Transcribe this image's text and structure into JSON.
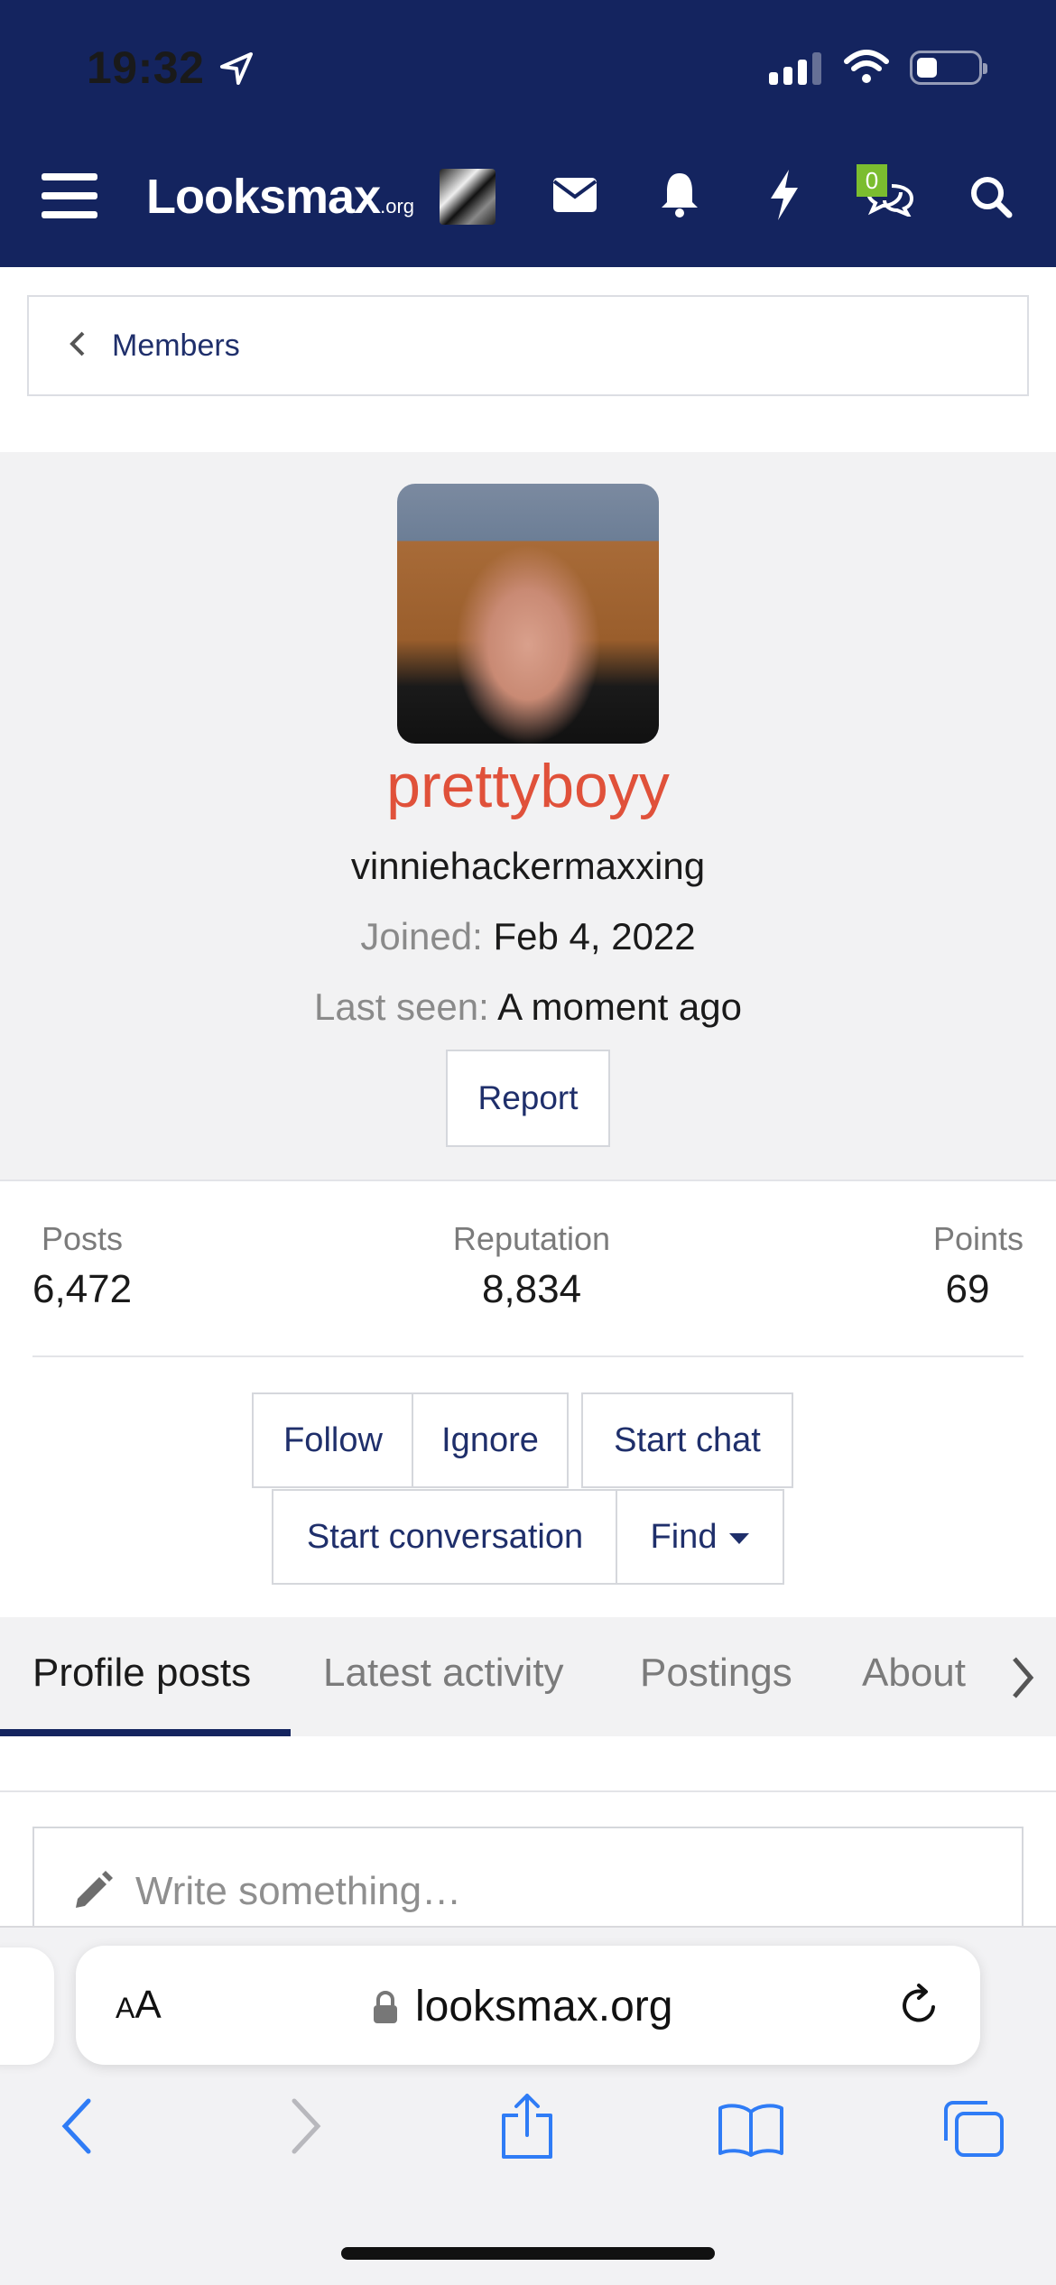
{
  "status_bar": {
    "time": "19:32"
  },
  "header": {
    "logo_main": "Looksmax",
    "logo_suffix": ".org",
    "chat_badge_count": "0",
    "icons": [
      "menu-icon",
      "mail-icon",
      "bell-icon",
      "bolt-icon",
      "chat-icon",
      "search-icon"
    ]
  },
  "breadcrumb": {
    "label": "Members"
  },
  "profile": {
    "username": "prettyboyy",
    "username_color": "#e0513a",
    "title": "vinniehackermaxxing",
    "joined_label": "Joined:",
    "joined_value": "Feb 4, 2022",
    "last_seen_label": "Last seen:",
    "last_seen_value": "A moment ago",
    "report_label": "Report"
  },
  "stats": {
    "posts_label": "Posts",
    "posts_value": "6,472",
    "reputation_label": "Reputation",
    "reputation_value": "8,834",
    "points_label": "Points",
    "points_value": "69"
  },
  "actions": {
    "follow": "Follow",
    "ignore": "Ignore",
    "start_chat": "Start chat",
    "start_conversation": "Start conversation",
    "find": "Find"
  },
  "tabs": [
    {
      "label": "Profile posts",
      "active": true
    },
    {
      "label": "Latest activity",
      "active": false
    },
    {
      "label": "Postings",
      "active": false
    },
    {
      "label": "About",
      "active": false
    }
  ],
  "composer": {
    "placeholder": "Write something…"
  },
  "browser": {
    "text_size_label": "AA",
    "url": "looksmax.org"
  },
  "colors": {
    "nav_bg": "#14245f",
    "link": "#1f2f6b",
    "accent_badge": "#7bbd2f"
  }
}
